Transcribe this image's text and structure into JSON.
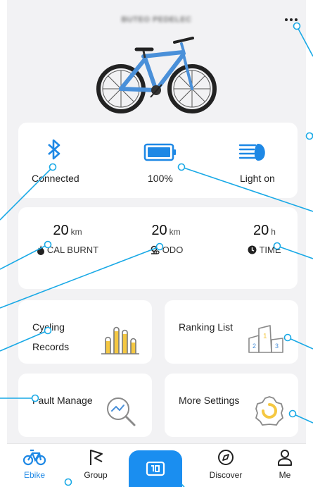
{
  "header": {
    "device_name": "BUTEO PEDELEC"
  },
  "status": {
    "bluetooth_label": "Connected",
    "battery_label": "100%",
    "battery_level": 1.0,
    "light_label": "Light on"
  },
  "stats": [
    {
      "value": "20",
      "unit": "km",
      "label": "CAL BURNT",
      "icon": "flame-icon"
    },
    {
      "value": "20",
      "unit": "km",
      "label": "ODO",
      "icon": "odometer-icon"
    },
    {
      "value": "20",
      "unit": "h",
      "label": "TIME",
      "icon": "clock-icon"
    }
  ],
  "tiles": {
    "cycling_records": "Cycling Records",
    "ranking_list": "Ranking List",
    "fault_manage": "Fault Manage",
    "more_settings": "More Settings"
  },
  "tabs": {
    "ebike": "Ebike",
    "group": "Group",
    "discover": "Discover",
    "me": "Me"
  },
  "colors": {
    "accent": "#1a8ef0",
    "callout": "#19a9e6",
    "chart_yellow": "#f5c842"
  }
}
